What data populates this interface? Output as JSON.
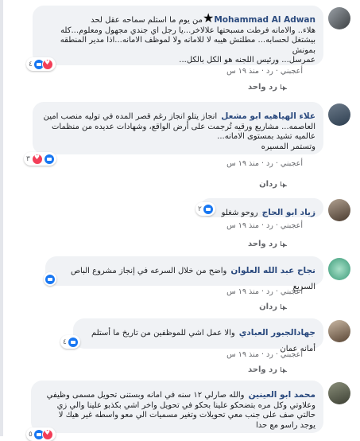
{
  "comments": [
    {
      "author": "Mohammad Al Adwan",
      "text_lines": [
        "من يوم ما استلم سماحه عقل لحد",
        "هلاء.. والامانه فرطت مسبحتها علالاخر...يا رجل اي جندي مجهول ومعلوم...كله",
        "بيشتغل لحسابه... مطلتش هيبه لا للامانه ولا لموظف الامانه...اذا مدير المنطقه بمونش",
        "عمرسل... ورئيس اللجنه هو الكل بالكل..."
      ],
      "reactions": "٤",
      "actions": "أعجبني · رد · منذ ١٩ س",
      "replies": "رد واحد"
    },
    {
      "author": "علاء الهياهيه ابو مشعل",
      "text_lines": [
        "انجاز يتلو انجاز رغم قصر المده في توليه منصب امين",
        "العاصمه... مشاريع ورقيه تُرجمت على أرض الواقع، وشهادات عديده من منظمات",
        "عالميه تشيد بمستوى الامانه...",
        "وتستمر المسيره"
      ],
      "reactions": "٣",
      "actions": "أعجبني · رد · منذ ١٩ س",
      "replies": "ردان"
    },
    {
      "author": "زياد ابو الحاج",
      "text_lines": [
        "روحو شغلو"
      ],
      "reactions": "٢",
      "actions": "أعجبني · رد · منذ ١٩ س",
      "replies": "رد واحد"
    },
    {
      "author": "نجاح عبد الله العلوان",
      "text_lines": [
        "واضح من خلال السرعه في إنجاز مشروع الباص السريع"
      ],
      "reactions": "",
      "actions": "أعجبني · رد · منذ ١٩ س",
      "replies": "ردان"
    },
    {
      "author": "جهادالجبور العبادي",
      "text_lines": [
        "والا عمل اشي للموظفين من تاريخ ما أستلم أمانه عمان"
      ],
      "reactions": "٤",
      "actions": "أعجبني · رد · منذ ١٩ س",
      "replies": "رد واحد"
    },
    {
      "author": "محمد ابو العينين",
      "text_lines": [
        "والله صارلي ١٢ سنه في امانه وبستنى تحويل مسمى وظيفي",
        "وعلاوتي وكل مره بتضحكو علينا بحكو في تحويل واخر اشي بكذبو علينا والي زي",
        "حالتي صف على جنب معي تحويلات وتغير مسميات الي معو واسطه غير هيك لا",
        "يوجد راسو مع حدا"
      ],
      "reactions": "٥",
      "actions": "",
      "replies": ""
    }
  ],
  "colors": {
    "author": "#2b4a7e",
    "bubble": "#f0f2f5",
    "like": "#1877f2",
    "love": "#f33e58",
    "meta": "#65676b"
  }
}
